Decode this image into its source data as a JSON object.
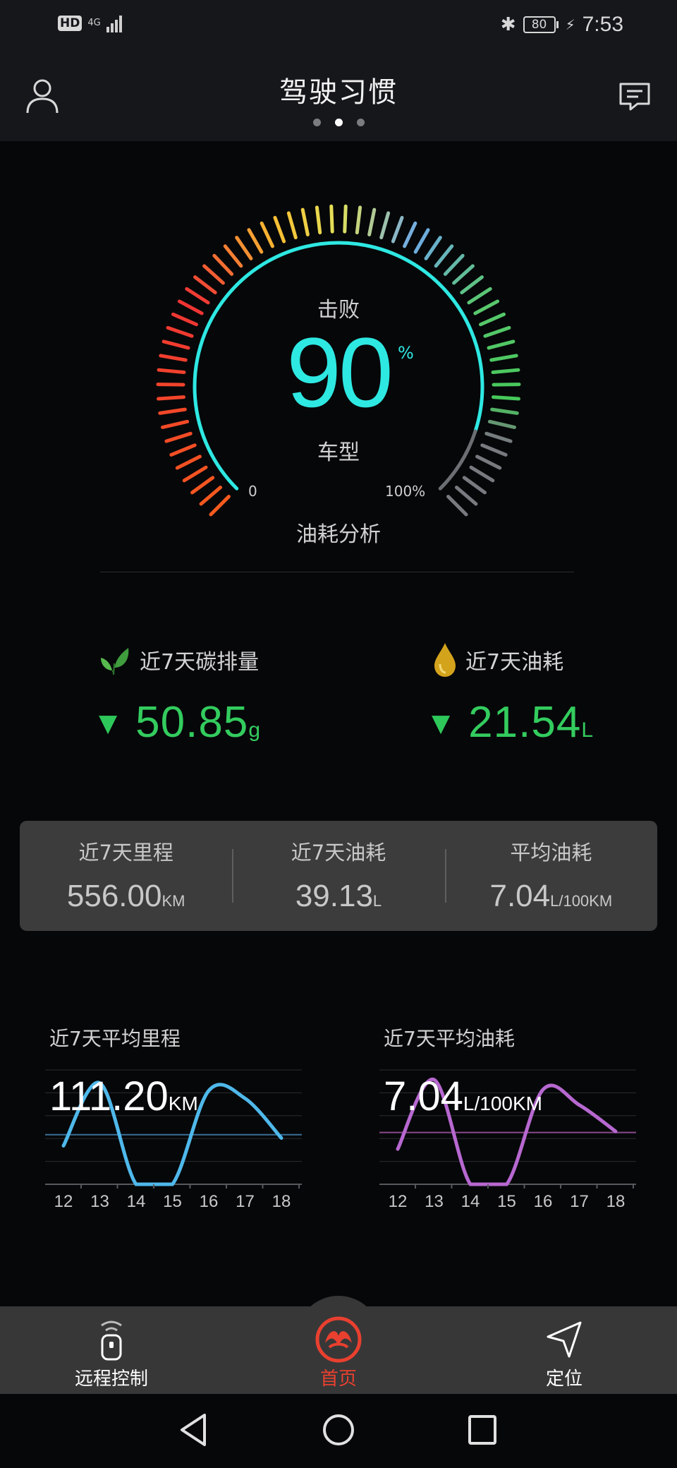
{
  "status_bar": {
    "hd": "HD",
    "network": "4G",
    "battery": "80",
    "time": "7:53",
    "icons": [
      "signal-icon",
      "bluetooth-icon",
      "battery-icon",
      "charging-icon"
    ]
  },
  "header": {
    "title": "驾驶习惯",
    "page_count": 3,
    "active_page": 1,
    "icons": [
      "user-icon",
      "message-icon"
    ]
  },
  "gauge": {
    "top_label": "击败",
    "value": "90",
    "unit": "%",
    "bottom_label": "车型",
    "min_label": "0",
    "max_label": "100%",
    "link_label": "油耗分析",
    "percent": 90,
    "ring_color": "#2ee8e2"
  },
  "summary": {
    "carbon": {
      "label": "近7天碳排量",
      "value": "50.85",
      "unit": "g",
      "icon": "leaf-icon",
      "trend": "down"
    },
    "fuel": {
      "label": "近7天油耗",
      "value": "21.54",
      "unit": "L",
      "icon": "oil-drop-icon",
      "trend": "down"
    },
    "trend_color": "#33cc5e"
  },
  "stats": [
    {
      "label": "近7天里程",
      "value": "556.00",
      "unit": "KM"
    },
    {
      "label": "近7天油耗",
      "value": "39.13",
      "unit": "L"
    },
    {
      "label": "平均油耗",
      "value": "7.04",
      "unit": "L/100KM"
    }
  ],
  "mini_charts": {
    "mileage": {
      "title": "近7天平均里程",
      "value": "111.20",
      "unit": "KM",
      "color": "#4fb8ea",
      "avg_line_color": "#3a6f95"
    },
    "fuel": {
      "title": "近7天平均油耗",
      "value": "7.04",
      "unit": "L/100KM",
      "color": "#b768d0",
      "avg_line_color": "#8a4a8a"
    }
  },
  "chart_data": [
    {
      "type": "line",
      "x": [
        "12",
        "13",
        "14",
        "15",
        "16",
        "17",
        "18"
      ],
      "series": [
        {
          "values": [
            0.35,
            0.92,
            0.0,
            0.0,
            0.85,
            0.78,
            0.42
          ]
        }
      ],
      "avg_line": 0.45
    },
    {
      "type": "line",
      "x": [
        "12",
        "13",
        "14",
        "15",
        "16",
        "17",
        "18"
      ],
      "series": [
        {
          "values": [
            0.32,
            0.95,
            0.0,
            0.0,
            0.86,
            0.72,
            0.48
          ]
        }
      ],
      "avg_line": 0.47
    }
  ],
  "bottom_nav": [
    {
      "label": "远程控制",
      "icon": "remote-key-icon",
      "active": false
    },
    {
      "label": "首页",
      "icon": "home-logo-icon",
      "active": true
    },
    {
      "label": "定位",
      "icon": "location-arrow-icon",
      "active": false
    }
  ],
  "active_color": "#e9402f"
}
